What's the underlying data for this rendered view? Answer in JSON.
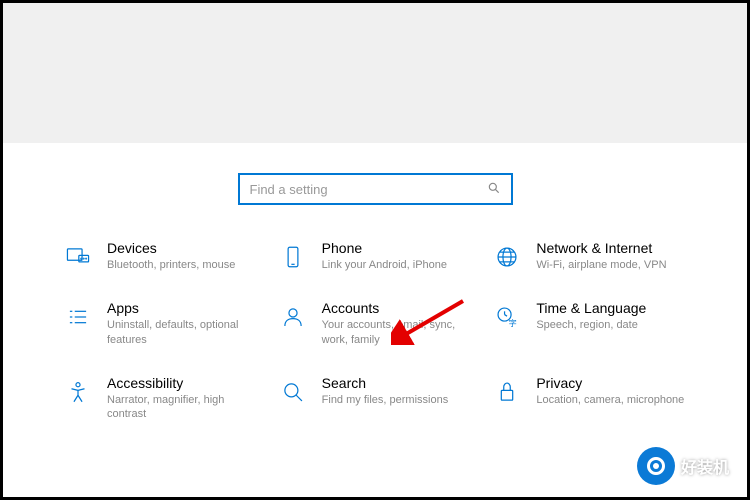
{
  "search": {
    "placeholder": "Find a setting"
  },
  "tiles": {
    "devices": {
      "title": "Devices",
      "desc": "Bluetooth, printers, mouse"
    },
    "phone": {
      "title": "Phone",
      "desc": "Link your Android, iPhone"
    },
    "network": {
      "title": "Network & Internet",
      "desc": "Wi-Fi, airplane mode, VPN"
    },
    "apps": {
      "title": "Apps",
      "desc": "Uninstall, defaults, optional features"
    },
    "accounts": {
      "title": "Accounts",
      "desc": "Your accounts, email, sync, work, family"
    },
    "time": {
      "title": "Time & Language",
      "desc": "Speech, region, date"
    },
    "accessibility": {
      "title": "Accessibility",
      "desc": "Narrator, magnifier, high contrast"
    },
    "searchTile": {
      "title": "Search",
      "desc": "Find my files, permissions"
    },
    "privacy": {
      "title": "Privacy",
      "desc": "Location, camera, microphone"
    }
  },
  "watermark": {
    "text": "好装机"
  }
}
